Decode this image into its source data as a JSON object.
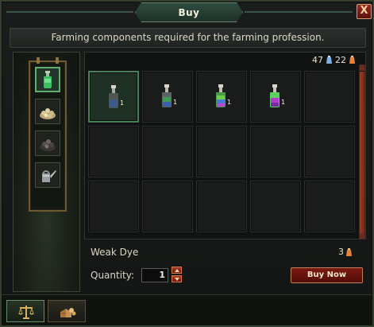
{
  "window": {
    "title": "Buy",
    "close_label": "X"
  },
  "subtitle": "Farming components required for the farming profession.",
  "categories": [
    {
      "name": "dye-bottles",
      "icon": "green-bottle-icon",
      "active": true
    },
    {
      "name": "seeds",
      "icon": "seed-pile-icon",
      "active": false
    },
    {
      "name": "fertilizer",
      "icon": "dark-seed-pile-icon",
      "active": false
    },
    {
      "name": "watering",
      "icon": "watering-can-icon",
      "active": false
    }
  ],
  "currency": {
    "primary": "47",
    "primary_icon": "blue-bag-icon",
    "secondary": "22",
    "secondary_icon": "orange-bag-icon"
  },
  "items": [
    {
      "icon": "grey-dye-bottle-icon",
      "qty": "1",
      "selected": true
    },
    {
      "icon": "green-dye-bottle-icon",
      "qty": "1",
      "selected": false
    },
    {
      "icon": "rainbow-dye-bottle-icon",
      "qty": "1",
      "selected": false
    },
    {
      "icon": "purple-green-dye-bottle-icon",
      "qty": "1",
      "selected": false
    }
  ],
  "selected_item": {
    "name": "Weak Dye",
    "price": "3",
    "price_icon": "orange-bag-icon"
  },
  "quantity": {
    "label": "Quantity:",
    "value": "1"
  },
  "buy_button": "Buy Now",
  "colors": {
    "accent_green": "#4b7f5a",
    "button_red": "#7c1a12",
    "title_green": "#2f4b3f"
  }
}
